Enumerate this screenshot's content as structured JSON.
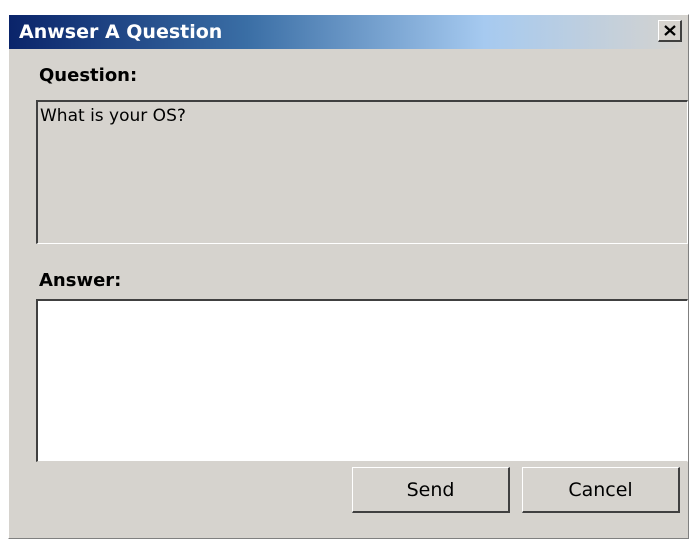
{
  "window": {
    "title": "Anwser A Question",
    "close_icon": "close-icon"
  },
  "question": {
    "label": "Question:",
    "text": "What is your OS?"
  },
  "answer": {
    "label": "Answer:",
    "value": "",
    "placeholder": ""
  },
  "buttons": {
    "send_label": "Send",
    "cancel_label": "Cancel"
  },
  "colors": {
    "title_gradient_start": "#0a246a",
    "title_gradient_end": "#d6d3ce",
    "dialog_face": "#d6d3ce",
    "answer_background": "#ffffff"
  }
}
